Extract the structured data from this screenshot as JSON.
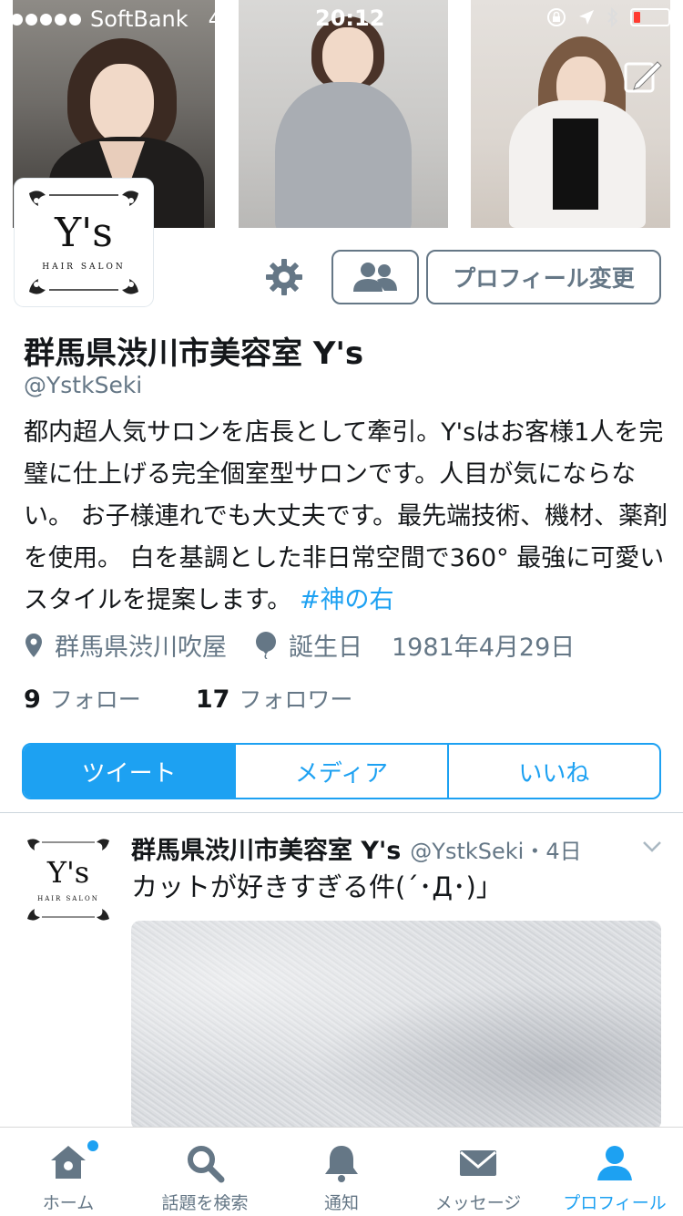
{
  "status_bar": {
    "carrier": "SoftBank",
    "network": "4G",
    "time": "20:12",
    "battery_level": 0.2
  },
  "profile": {
    "avatar_text": "Y's",
    "avatar_subtext": "HAIR SALON",
    "edit_button_label": "プロフィール変更",
    "name": "群馬県渋川市美容室 Y's",
    "handle": "@YstkSeki",
    "bio_text": "都内超人気サロンを店長として牽引。Y'sはお客様1人を完璧に仕上げる完全個室型サロンです。人目が気にならない。 お子様連れでも大丈夫です。最先端技術、機材、薬剤を使用。 白を基調とした非日常空間で360° 最強に可愛いスタイルを提案します。 ",
    "bio_hashtag": "#神の右",
    "location": "群馬県渋川吹屋",
    "birthday_label": "誕生日",
    "birthday": "1981年4月29日",
    "following_count": "9",
    "following_label": "フォロー",
    "followers_count": "17",
    "followers_label": "フォロワー"
  },
  "tabs": [
    {
      "label": "ツイート",
      "active": true
    },
    {
      "label": "メディア",
      "active": false
    },
    {
      "label": "いいね",
      "active": false
    }
  ],
  "tweet": {
    "name": "群馬県渋川市美容室 Y's",
    "handle_time": "@YstkSeki・4日",
    "text": "カットが好きすぎる件(´･Д･)」"
  },
  "tabbar": [
    {
      "label": "ホーム",
      "icon": "home-icon",
      "active": false,
      "badge": true
    },
    {
      "label": "話題を検索",
      "icon": "search-icon",
      "active": false
    },
    {
      "label": "通知",
      "icon": "bell-icon",
      "active": false
    },
    {
      "label": "メッセージ",
      "icon": "envelope-icon",
      "active": false
    },
    {
      "label": "プロフィール",
      "icon": "person-icon",
      "active": true
    }
  ],
  "colors": {
    "accent": "#1da1f2",
    "secondary_text": "#657786",
    "primary_text": "#14171a"
  }
}
